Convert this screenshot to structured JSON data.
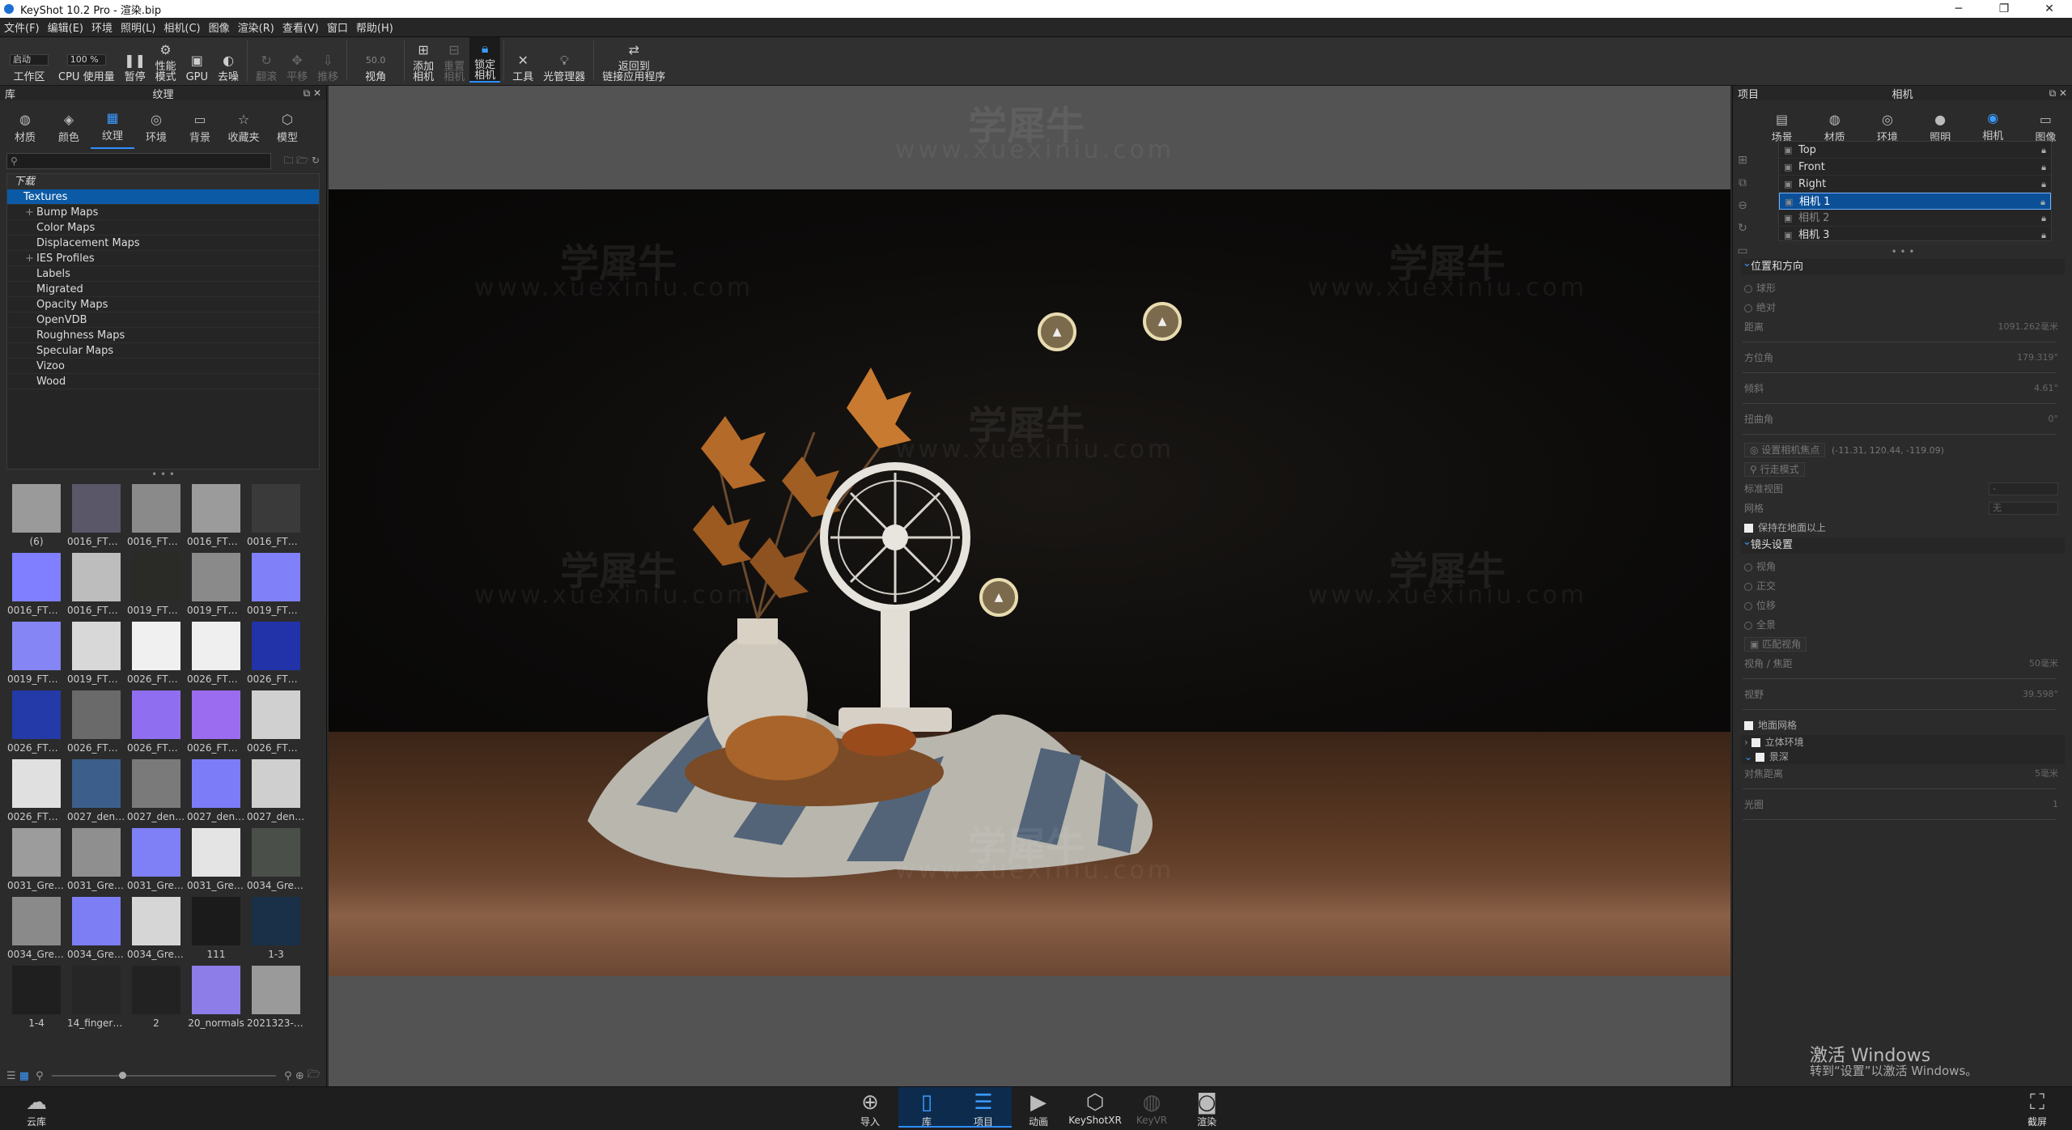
{
  "window": {
    "title": "KeyShot 10.2 Pro  - 渲染.bip",
    "minimize": "─",
    "maximize": "❐",
    "close": "✕"
  },
  "menu": [
    "文件(F)",
    "编辑(E)",
    "环境",
    "照明(L)",
    "相机(C)",
    "图像",
    "渲染(R)",
    "查看(V)",
    "窗口",
    "帮助(H)"
  ],
  "toolbar": {
    "workspace_mode": "启动",
    "workspace": "工作区",
    "cpu_pct": "100 %",
    "cpu": "CPU 使用量",
    "pause": "暂停",
    "perf": "性能\n模式",
    "gpu": "GPU",
    "denoise": "去噪",
    "flip": "翻滚",
    "pan": "平移",
    "dolly": "推移",
    "fov_value": "50.0",
    "view": "视角",
    "add_cam": "添加\n相机",
    "reset_cam": "重置\n相机",
    "lock_cam": "锁定\n相机",
    "tools": "工具",
    "light_mgr": "光管理器",
    "return_link": "返回到\n链接应用程序"
  },
  "library": {
    "panel_left": "库",
    "panel_title": "纹理",
    "tabs": [
      {
        "label": "材质",
        "icon": "sphere-icon"
      },
      {
        "label": "颜色",
        "icon": "palette-icon"
      },
      {
        "label": "纹理",
        "icon": "texture-icon"
      },
      {
        "label": "环境",
        "icon": "globe-icon"
      },
      {
        "label": "背景",
        "icon": "image-icon"
      },
      {
        "label": "收藏夹",
        "icon": "star-icon"
      },
      {
        "label": "模型",
        "icon": "cube-icon"
      }
    ],
    "search_placeholder": "",
    "tree_header": "下载",
    "tree_root": "Textures",
    "tree_items": [
      "Bump Maps",
      "Color Maps",
      "Displacement Maps",
      "IES Profiles",
      "Labels",
      "Migrated",
      "Opacity Maps",
      "OpenVDB",
      "Roughness Maps",
      "Specular Maps",
      "Vizoo",
      "Wood"
    ],
    "thumbs": [
      {
        "label": "(6)",
        "color": "#9a9a9a"
      },
      {
        "label": "0016_FTW_...",
        "color": "#5a5868"
      },
      {
        "label": "0016_FTW_...",
        "color": "#8a8a8a"
      },
      {
        "label": "0016_FTW_...",
        "color": "#9b9b9b"
      },
      {
        "label": "0016_FTW_...",
        "color": "#3a3a3a"
      },
      {
        "label": "0016_FTW_...",
        "color": "#7f7fff"
      },
      {
        "label": "0016_FTW_...",
        "color": "#bdbdbd"
      },
      {
        "label": "0019_FTW_...",
        "color": "#2a2a26"
      },
      {
        "label": "0019_FTW_...",
        "color": "#8a8a8a"
      },
      {
        "label": "0019_FTW_...",
        "color": "#8080f8"
      },
      {
        "label": "0019_FTW_...",
        "color": "#8585f5"
      },
      {
        "label": "0019_FTW_...",
        "color": "#d8d8d8"
      },
      {
        "label": "0026_FTW_...",
        "color": "#f0f0f0"
      },
      {
        "label": "0026_FTW_...",
        "color": "#efefef"
      },
      {
        "label": "0026_FTW_...",
        "color": "#2233aa"
      },
      {
        "label": "0026_FTW_...",
        "color": "#233aa8"
      },
      {
        "label": "0026_FTW_...",
        "color": "#6a6a6a"
      },
      {
        "label": "0026_FTW_...",
        "color": "#8f6ef0"
      },
      {
        "label": "0026_FTW_...",
        "color": "#9b6cf0"
      },
      {
        "label": "0026_FTW_...",
        "color": "#d0d0d0"
      },
      {
        "label": "0026_FTW_...",
        "color": "#e0e0e0"
      },
      {
        "label": "0027_deni...",
        "color": "#3b5f8a"
      },
      {
        "label": "0027_deni...",
        "color": "#7a7a7a"
      },
      {
        "label": "0027_deni...",
        "color": "#7c7cf8"
      },
      {
        "label": "0027_deni...",
        "color": "#cfcfcf"
      },
      {
        "label": "0031_Grey...",
        "color": "#9c9c9c"
      },
      {
        "label": "0031_Grey...",
        "color": "#8f8f8f"
      },
      {
        "label": "0031_Grey...",
        "color": "#7f7ff6"
      },
      {
        "label": "0031_Grey...",
        "color": "#e4e4e4"
      },
      {
        "label": "0034_Grey...",
        "color": "#4a4f4a"
      },
      {
        "label": "0034_Grey...",
        "color": "#8a8a8a"
      },
      {
        "label": "0034_Grey...",
        "color": "#7d7df4"
      },
      {
        "label": "0034_Grey...",
        "color": "#d6d6d6"
      },
      {
        "label": "111",
        "color": "#1b1b1b"
      },
      {
        "label": "1-3",
        "color": "#1a3048"
      },
      {
        "label": "1-4",
        "color": "#1f1f1f"
      },
      {
        "label": "14_fingerp...",
        "color": "#262626"
      },
      {
        "label": "2",
        "color": "#222222"
      },
      {
        "label": "20_normals",
        "color": "#8d7de8"
      },
      {
        "label": "2021323-1...",
        "color": "#9a9a9a"
      }
    ]
  },
  "project": {
    "panel_left": "项目",
    "panel_title": "相机",
    "tabs": [
      {
        "label": "场景",
        "icon": "scene-icon"
      },
      {
        "label": "材质",
        "icon": "sphere-icon"
      },
      {
        "label": "环境",
        "icon": "globe-icon"
      },
      {
        "label": "照明",
        "icon": "bulb-icon"
      },
      {
        "label": "相机",
        "icon": "camera-icon"
      },
      {
        "label": "图像",
        "icon": "image-icon"
      }
    ],
    "cameras": [
      "Top",
      "Front",
      "Right",
      "相机 1",
      "相机 2",
      "相机 3"
    ],
    "sec_position": "位置和方向",
    "orbit": "球形",
    "absolute": "绝对",
    "distance": "距离",
    "distance_v": "1091.262毫米",
    "azimuth": "方位角",
    "azimuth_v": "179.319°",
    "incline": "倾斜",
    "incline_v": "4.61°",
    "twist": "扭曲角",
    "twist_v": "0°",
    "focus": "设置相机焦点",
    "focus_v": "(-11.31, 120.44, -119.09)",
    "walk": "行走模式",
    "std_view": "标准视图",
    "std_view_v": "-",
    "grid": "网格",
    "grid_v": "无",
    "keep_ground": "保持在地面以上",
    "sec_lens": "镜头设置",
    "lens_opts": [
      "视角",
      "正交",
      "位移",
      "全景"
    ],
    "match": "匹配视角",
    "fov_focal": "视角 / 焦距",
    "fov_focal_v": "50毫米",
    "fov": "视野",
    "fov_v": "39.598°",
    "perspective_grid": "地面网格",
    "stereo": "立体环境",
    "dof": "景深",
    "focus_dist": "对焦距离",
    "focus_dist_v": "5毫米",
    "aperture": "光圈",
    "aperture_v": "1"
  },
  "viewport": {
    "watermark_cn": "学犀牛",
    "watermark_url": "www.xuexiniu.com",
    "activate": "激活 Windows",
    "activate_sub": "转到“设置”以激活 Windows。"
  },
  "bottombar": {
    "cloud": "云库",
    "import": "导入",
    "library": "库",
    "project": "项目",
    "animation": "动画",
    "keyshotxr": "KeyShotXR",
    "keyvr": "KeyVR",
    "render": "渲染",
    "screenshot": "截屏"
  }
}
